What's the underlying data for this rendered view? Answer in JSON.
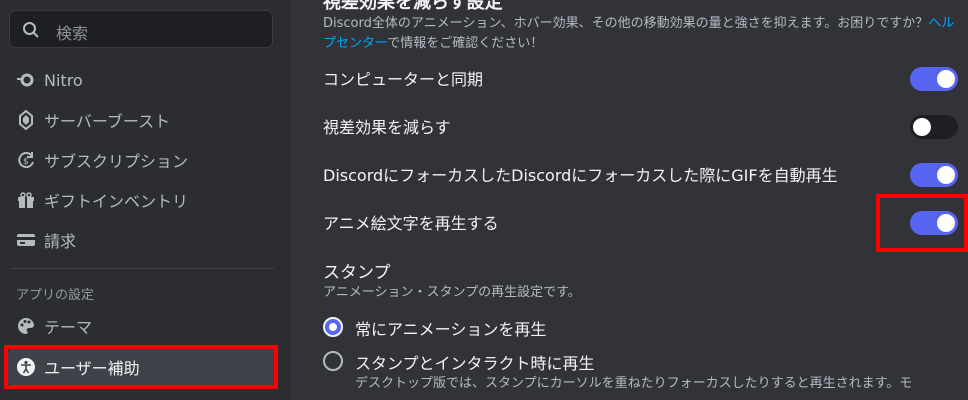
{
  "sidebar": {
    "search_placeholder": "検索",
    "items": [
      {
        "label": "Nitro",
        "icon": "nitro-icon"
      },
      {
        "label": "サーバーブースト",
        "icon": "boost-icon"
      },
      {
        "label": "サブスクリプション",
        "icon": "subscription-icon"
      },
      {
        "label": "ギフトインベントリ",
        "icon": "gift-icon"
      },
      {
        "label": "請求",
        "icon": "billing-icon"
      }
    ],
    "app_settings_header": "アプリの設定",
    "app_items": [
      {
        "label": "テーマ",
        "icon": "palette-icon"
      },
      {
        "label": "ユーザー補助",
        "icon": "accessibility-icon"
      }
    ]
  },
  "main": {
    "section_title": "視差効果を減らす設定",
    "description_before": "Discord全体のアニメーション、ホバー効果、その他の移動効果の量と強さを抑えます。お困りですか？",
    "description_link": "ヘルプセンター",
    "description_after": "で情報をご確認ください！",
    "toggles": [
      {
        "label": "コンピューターと同期",
        "state": "on"
      },
      {
        "label": "視差効果を減らす",
        "state": "off"
      },
      {
        "label": "DiscordにフォーカスしたDiscordにフォーカスした際にGIFを自動再生",
        "state": "on"
      },
      {
        "label": "アニメ絵文字を再生する",
        "state": "on"
      }
    ],
    "stickers_title": "スタンプ",
    "stickers_description": "アニメーション・スタンプの再生設定です。",
    "radio_options": [
      {
        "label": "常にアニメーションを再生",
        "checked": true
      },
      {
        "label": "スタンプとインタラクト時に再生",
        "checked": false
      }
    ],
    "radio_note": "デスクトップ版では、スタンプにカーソルを重ねたりフォーカスしたりすると再生されます。モ"
  },
  "colors": {
    "accent": "#5865f2",
    "highlight_outline": "#ff0000"
  }
}
